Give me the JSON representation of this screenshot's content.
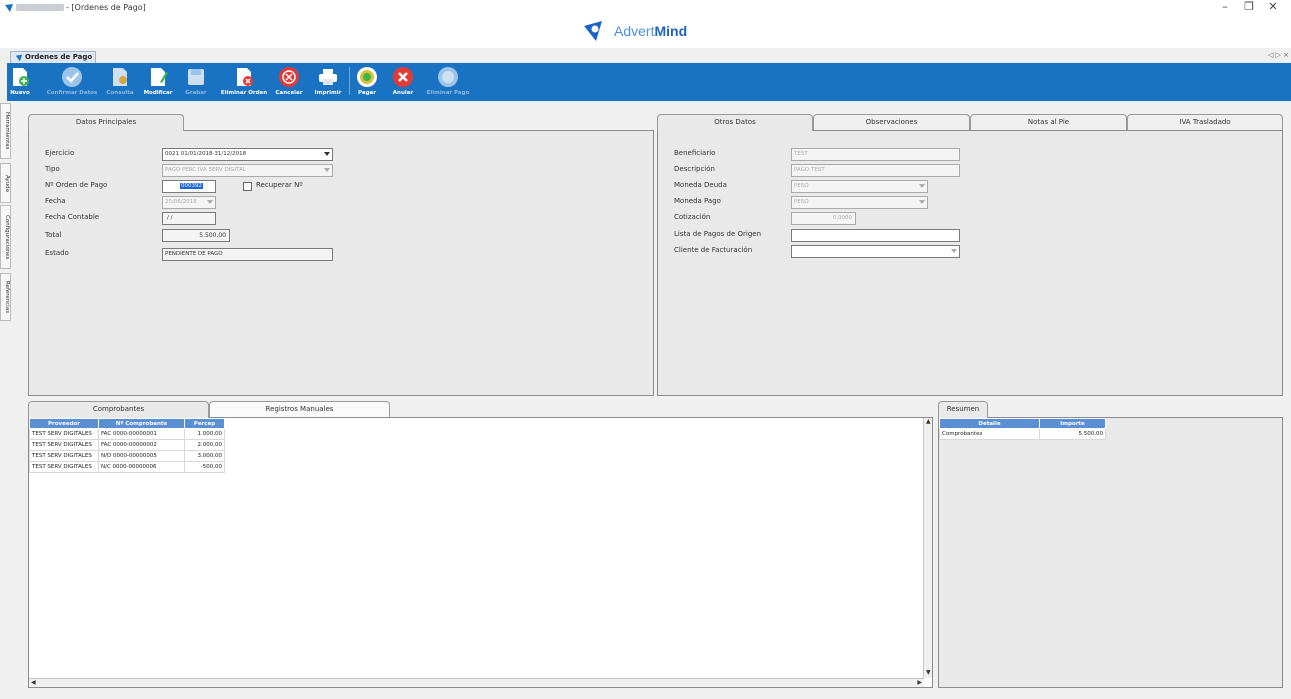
{
  "window": {
    "title": "- [Ordenes de Pago]",
    "controls": {
      "minimize": "–",
      "maximize": "❐",
      "close": "✕"
    }
  },
  "brand": {
    "name_light": "Advert",
    "name_bold": "Mind"
  },
  "doc_tab": {
    "label": "Ordenes de Pago",
    "nav": "◁ ▷ ×"
  },
  "toolbar": {
    "buttons": [
      {
        "label": "Nuevo",
        "icon": "new-document-icon",
        "enabled": true
      },
      {
        "label": "Confirmar Datos",
        "icon": "check-icon",
        "enabled": false
      },
      {
        "label": "Consulta",
        "icon": "search-document-icon",
        "enabled": false
      },
      {
        "label": "Modificar",
        "icon": "edit-document-icon",
        "enabled": true
      },
      {
        "label": "Grabar",
        "icon": "save-icon",
        "enabled": false
      },
      {
        "label": "Eliminar Orden",
        "icon": "delete-document-icon",
        "enabled": true
      },
      {
        "label": "Cancelar",
        "icon": "cancel-icon",
        "enabled": true
      },
      {
        "label": "Imprimir",
        "icon": "printer-icon",
        "enabled": true
      },
      {
        "label": "Pagar",
        "icon": "pay-coin-icon",
        "enabled": true
      },
      {
        "label": "Anular",
        "icon": "void-icon",
        "enabled": true
      },
      {
        "label": "Eliminar Pago",
        "icon": "delete-payment-icon",
        "enabled": false
      }
    ]
  },
  "side_tabs": [
    "Herramientas",
    "Ayuda",
    "Configuraciones",
    "Referencias"
  ],
  "main_panel": {
    "tab": "Datos Principales",
    "labels": {
      "ejercicio": "Ejercicio",
      "tipo": "Tipo",
      "orden": "Nº Orden de Pago",
      "fecha": "Fecha",
      "fecha_contable": "Fecha Contable",
      "total": "Total",
      "estado": "Estado",
      "recuperar": "Recuperar Nº"
    },
    "values": {
      "ejercicio": "0021 01/01/2018-31/12/2018",
      "tipo": "PAGO PERC IVA SERV DIGITAL",
      "orden": "000392",
      "fecha": "25/06/2018",
      "fecha_contable": "/  /",
      "total": "5.500,00",
      "estado": "PENDIENTE DE PAGO"
    }
  },
  "otros_panel": {
    "tabs": [
      "Otros Datos",
      "Observaciones",
      "Notas al Pie",
      "IVA Trasladado"
    ],
    "labels": {
      "beneficiario": "Beneficiario",
      "descripcion": "Descripción",
      "moneda_deuda": "Moneda Deuda",
      "moneda_pago": "Moneda Pago",
      "cotizacion": "Cotización",
      "lista_pagos": "Lista de Pagos de Origen",
      "cliente_fact": "Cliente de Facturación"
    },
    "values": {
      "beneficiario": "TEST",
      "descripcion": "PAGO TEST",
      "moneda_deuda": "PESO",
      "moneda_pago": "PESO",
      "cotizacion": "0,0000",
      "lista_pagos": "",
      "cliente_fact": ""
    }
  },
  "comprobantes": {
    "tabs": [
      "Comprobantes",
      "Registros Manuales"
    ],
    "columns": [
      "Proveedor",
      "Nº Comprobante",
      "Percep"
    ],
    "rows": [
      [
        "TEST SERV DIGITALES",
        "FAC 0000-00000001",
        "1.000,00"
      ],
      [
        "TEST SERV DIGITALES",
        "FAC 0000-00000002",
        "2.000,00"
      ],
      [
        "TEST SERV DIGITALES",
        "N/D 0000-00000005",
        "3.000,00"
      ],
      [
        "TEST SERV DIGITALES",
        "N/C 0000-00000006",
        "-500,00"
      ]
    ]
  },
  "resumen": {
    "tab": "Resumen",
    "columns": [
      "Detalle",
      "Importe"
    ],
    "rows": [
      [
        "Comprobantes",
        "5.500,00"
      ]
    ]
  },
  "colors": {
    "toolbar": "#1a73c2",
    "grid_header": "#5b8fd4",
    "selection": "#1967d2"
  }
}
